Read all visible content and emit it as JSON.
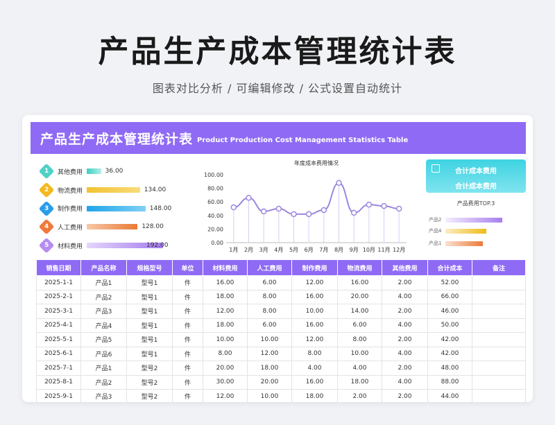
{
  "header": {
    "title": "产品生产成本管理统计表",
    "subtitle": "图表对比分析 /  可编辑修改  /  公式设置自动统计"
  },
  "banner": {
    "title_cn": "产品生产成本管理统计表",
    "title_en": "Product Production Cost Management Statistics Table"
  },
  "cost_breakdown": {
    "items": [
      {
        "num": "1",
        "label": "其他费用",
        "value": "36.00",
        "amount": 36,
        "color": "#4fd1c5",
        "bar_from": "#3fcfc0",
        "bar_to": "#b2eee8"
      },
      {
        "num": "2",
        "label": "物流费用",
        "value": "134.00",
        "amount": 134,
        "color": "#f5b81e",
        "bar_from": "#f2c230",
        "bar_to": "#f7dc7a"
      },
      {
        "num": "3",
        "label": "制作费用",
        "value": "148.00",
        "amount": 148,
        "color": "#2a9de8",
        "bar_from": "#1fa3e8",
        "bar_to": "#7fd1f5"
      },
      {
        "num": "4",
        "label": "人工费用",
        "value": "128.00",
        "amount": 128,
        "color": "#ee7a3c",
        "bar_from": "#f7c9a8",
        "bar_to": "#ea7a34"
      },
      {
        "num": "5",
        "label": "材料费用",
        "value": "192.00",
        "amount": 192,
        "color": "#b58df0",
        "bar_from": "#e4d6fb",
        "bar_to": "#a47cf0"
      }
    ]
  },
  "chart_data": {
    "type": "line",
    "title": "年度成本费用情况",
    "categories": [
      "1月",
      "2月",
      "3月",
      "4月",
      "5月",
      "6月",
      "7月",
      "8月",
      "9月",
      "10月",
      "11月",
      "12月"
    ],
    "values": [
      52,
      66,
      46,
      50,
      42,
      42,
      48,
      88,
      44,
      56,
      54,
      50
    ],
    "ylim": [
      0,
      100
    ],
    "yticks": [
      "0.00",
      "20.00",
      "40.00",
      "60.00",
      "80.00",
      "100.00"
    ],
    "color": "#9b86e0"
  },
  "totals": {
    "label_top": "合计成本费用",
    "label_bottom": "合计成本费用"
  },
  "top3": {
    "title": "产品费用TOP.3",
    "items": [
      {
        "label": "产品2",
        "share": 1.0,
        "from": "#f3eefd",
        "to": "#a77ff0"
      },
      {
        "label": "产品4",
        "share": 0.72,
        "from": "#fbeec4",
        "to": "#f0bb18"
      },
      {
        "label": "产品1",
        "share": 0.66,
        "from": "#fbe0cf",
        "to": "#ec7b3a"
      }
    ]
  },
  "table": {
    "headers": [
      "销售日期",
      "产品名称",
      "规格型号",
      "单位",
      "材料费用",
      "人工费用",
      "制作费用",
      "物流费用",
      "其他费用",
      "合计成本",
      "备注"
    ],
    "rows": [
      [
        "2025-1-1",
        "产品1",
        "型号1",
        "件",
        "16.00",
        "6.00",
        "12.00",
        "16.00",
        "2.00",
        "52.00",
        ""
      ],
      [
        "2025-2-1",
        "产品2",
        "型号1",
        "件",
        "18.00",
        "8.00",
        "16.00",
        "20.00",
        "4.00",
        "66.00",
        ""
      ],
      [
        "2025-3-1",
        "产品3",
        "型号1",
        "件",
        "12.00",
        "8.00",
        "10.00",
        "14.00",
        "2.00",
        "46.00",
        ""
      ],
      [
        "2025-4-1",
        "产品4",
        "型号1",
        "件",
        "18.00",
        "6.00",
        "16.00",
        "6.00",
        "4.00",
        "50.00",
        ""
      ],
      [
        "2025-5-1",
        "产品5",
        "型号1",
        "件",
        "10.00",
        "10.00",
        "12.00",
        "8.00",
        "2.00",
        "42.00",
        ""
      ],
      [
        "2025-6-1",
        "产品6",
        "型号1",
        "件",
        "8.00",
        "12.00",
        "8.00",
        "10.00",
        "4.00",
        "42.00",
        ""
      ],
      [
        "2025-7-1",
        "产品1",
        "型号2",
        "件",
        "20.00",
        "18.00",
        "4.00",
        "4.00",
        "2.00",
        "48.00",
        ""
      ],
      [
        "2025-8-1",
        "产品2",
        "型号2",
        "件",
        "30.00",
        "20.00",
        "16.00",
        "18.00",
        "4.00",
        "88.00",
        ""
      ],
      [
        "2025-9-1",
        "产品3",
        "型号2",
        "件",
        "12.00",
        "10.00",
        "18.00",
        "2.00",
        "2.00",
        "44.00",
        ""
      ]
    ]
  }
}
